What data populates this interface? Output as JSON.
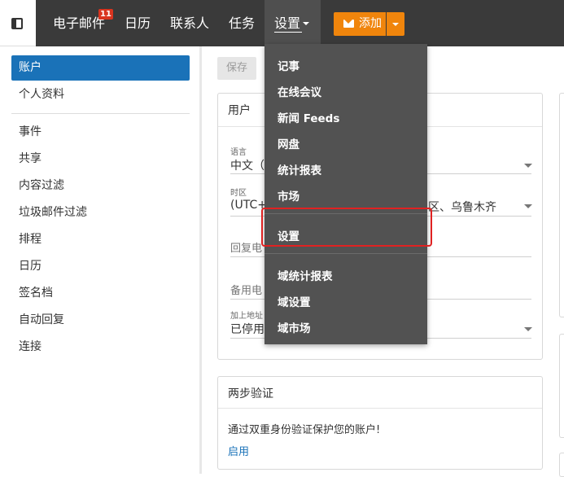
{
  "nav": {
    "items": [
      {
        "label": "电子邮件",
        "badge": "11"
      },
      {
        "label": "日历"
      },
      {
        "label": "联系人"
      },
      {
        "label": "任务"
      },
      {
        "label": "设置"
      }
    ],
    "add_button": "添加"
  },
  "sidebar": {
    "items": [
      "账户",
      "个人资料",
      "事件",
      "共享",
      "内容过滤",
      "垃圾邮件过滤",
      "排程",
      "日历",
      "签名档",
      "自动回复",
      "连接"
    ]
  },
  "toolbar": {
    "save_label": "保存"
  },
  "user_panel": {
    "title": "用户",
    "language_label": "语言",
    "language_value": "中文（",
    "timezone_label": "时区",
    "timezone_value_left": "(UTC+0",
    "timezone_value_right": "区、乌鲁木齐",
    "reply_label": "回复电",
    "backup_label": "备用电",
    "add_label": "加上地址",
    "add_value": "已停用"
  },
  "twofa_panel": {
    "title": "两步验证",
    "description": "通过双重身份验证保护您的账户!",
    "enable_link": "启用"
  },
  "settings_menu": {
    "items": [
      "记事",
      "在线会议",
      "新闻 Feeds",
      "网盘",
      "统计报表",
      "市场",
      "设置",
      "域统计报表",
      "域设置",
      "域市场"
    ]
  },
  "colors": {
    "accent": "#1a72b8",
    "add_button": "#f0850c",
    "topbar": "#3a3a3a",
    "menu": "#525252",
    "highlight": "#e02222"
  }
}
